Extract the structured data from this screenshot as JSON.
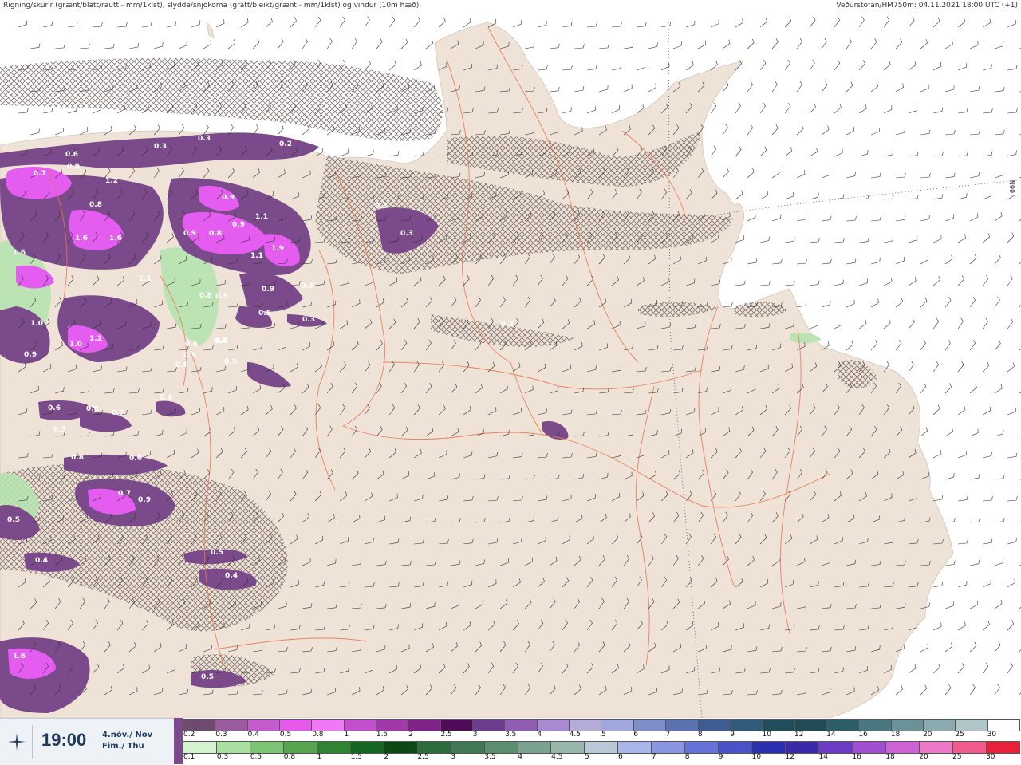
{
  "header": {
    "title_left": "Rigning/skúrir (grænt/blátt/rautt - mm/1klst), slydda/snjókoma (grátt/bleikt/grænt - mm/1klst) og vindur (10m hæð)",
    "title_right": "Veðurstofan/HM750m: 04.11.2021 18:00 UTC (+1)"
  },
  "footer": {
    "time": "19:00",
    "date_is": "4.nóv./ Nov",
    "day": "Fim./ Thu",
    "icon": "weather-logo-icon"
  },
  "colors": {
    "land": "#efe3d7",
    "sea": "#ffffff",
    "roads": "#e8774f",
    "snow_light": "#7a4a8a",
    "snow_mid": "#b44fc4",
    "snow_high": "#e45cf0",
    "rain_light": "#b6e2b0",
    "hatch": "#6b5a5a"
  },
  "scale_top": {
    "labels": [
      "0.2",
      "0.3",
      "0.4",
      "0.5",
      "0.8",
      "1",
      "1.5",
      "2",
      "2.5",
      "3",
      "3.5",
      "4",
      "4.5",
      "5",
      "6",
      "7",
      "8",
      "9",
      "10",
      "12",
      "14",
      "16",
      "18",
      "20",
      "25",
      "30"
    ],
    "colors": [
      "#6d4a6e",
      "#9a5a9e",
      "#c25ccc",
      "#e35ae8",
      "#f07af5",
      "#c24fcc",
      "#a03aa8",
      "#7e2486",
      "#4e0c57",
      "#6c3d8c",
      "#8f5cb0",
      "#a88ad0",
      "#b6acd8",
      "#a0a8dc",
      "#7d8fc8",
      "#5b72ae",
      "#3f5c92",
      "#2f5a7a",
      "#204c5c",
      "#1f4a56",
      "#2d5e68",
      "#4a7880",
      "#6a9298",
      "#8aaab0",
      "#b0c6c8",
      "#ffffff"
    ]
  },
  "scale_bottom": {
    "labels": [
      "0.1",
      "0.3",
      "0.5",
      "0.8",
      "1",
      "1.5",
      "2",
      "2.5",
      "3",
      "3.5",
      "4",
      "4.5",
      "5",
      "6",
      "7",
      "8",
      "9",
      "10",
      "12",
      "14",
      "16",
      "18",
      "20",
      "25",
      "30"
    ],
    "colors": [
      "#d4f4cf",
      "#a9dfa0",
      "#7cc473",
      "#55a64e",
      "#2f8431",
      "#146620",
      "#0b4a15",
      "#2c6b3c",
      "#3f7a55",
      "#5a8e6e",
      "#7aa28e",
      "#99b6ac",
      "#b8c8d6",
      "#aab6ea",
      "#8a96e4",
      "#6672d8",
      "#4a52c6",
      "#2c30b0",
      "#3a2aa8",
      "#6a3cc4",
      "#a24ed2",
      "#d062d8",
      "#ee78c8",
      "#f25c8c",
      "#e8203a"
    ]
  },
  "precip_labels": [
    "0.3",
    "0.3",
    "0.3",
    "0.2",
    "0.6",
    "0.7",
    "0.9",
    "1.2",
    "0.8",
    "1.6",
    "1.6",
    "1.6",
    "0.9",
    "0.9",
    "0.9",
    "1.1",
    "1.9",
    "1.1",
    "0.8",
    "0.9",
    "0.5",
    "0.3",
    "0.3",
    "0.3",
    "0.3",
    "0.5",
    "0.3",
    "0.6",
    "0.4",
    "0.8",
    "0.6",
    "0.5",
    "0.4",
    "0.6",
    "0.8",
    "0.7",
    "0.3",
    "0.8",
    "0.6",
    "0.7",
    "0.9",
    "0.5",
    "0.4",
    "0.5",
    "0.4",
    "1.6",
    "0.5",
    "1.0",
    "1.2",
    "1.0",
    "1.1",
    "0.9",
    "0.4",
    "0.5"
  ],
  "grid_label": "66N"
}
